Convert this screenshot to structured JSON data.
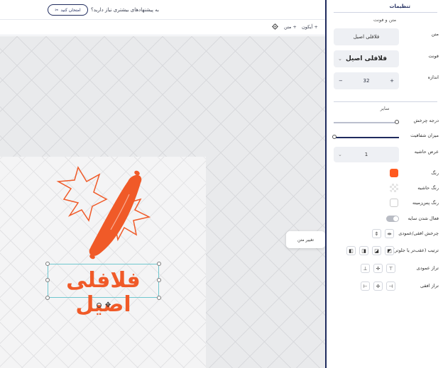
{
  "topbar": {
    "question": "به پیشنهادهای بیشتری نیاز دارید؟",
    "try_button": "امتحان کنید",
    "try_icon": "sparkle-icon"
  },
  "toolbar": {
    "text_label": "متن",
    "icon_label": "آیکون",
    "add_symbol": "+",
    "settings_icon": "gear-icon"
  },
  "canvas": {
    "logo_text": "فلافلی اصیل",
    "context_menu_label": "تغییر متن"
  },
  "panel": {
    "title": "تنظیمات",
    "text_font_section": "متن و فونت",
    "text_label": "متن",
    "text_value": "فلافلی اصیل",
    "font_label": "فونت",
    "font_value": "فلافلی اصیل",
    "size_label": "اندازه",
    "size_value": "32",
    "size_minus": "−",
    "size_plus": "+",
    "other_section": "سایر",
    "rotation_label": "درجه چرخش",
    "opacity_label": "میزان شفافیت",
    "border_width_label": "عرض حاشیه",
    "border_width_value": "1",
    "color_label": "رنگ",
    "color_value": "#ff5a1f",
    "border_color_label": "رنگ حاشیه",
    "bg_color_label": "رنگ پس‌زمینه",
    "shadow_label": "فعال شدن سایه",
    "flip_label": "چرخش افقی/عمودی",
    "order_label": "ترتیب (عقب‌تر یا جلوتر)",
    "v_align_label": "تراز عمودی",
    "h_align_label": "تراز افقی",
    "rotation_value": 0.9,
    "opacity_value": 0.0
  },
  "colors": {
    "accent": "#1f2b5e",
    "logo_orange": "#f05a28"
  }
}
